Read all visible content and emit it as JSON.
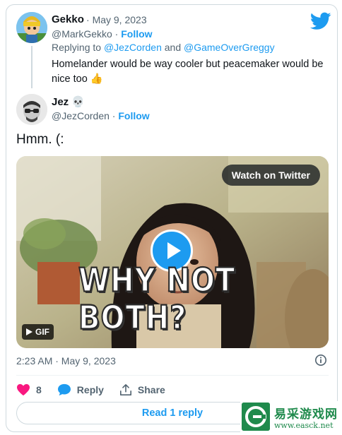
{
  "quoted_tweet": {
    "display_name": "Gekko",
    "date": "May 9, 2023",
    "handle": "@MarkGekko",
    "follow_label": "Follow",
    "replying_prefix": "Replying to",
    "replying_user_1": "@JezCorden",
    "replying_and": "and",
    "replying_user_2": "@GameOverGreggy",
    "text": "Homelander would be way cooler but peacemaker would be nice too 👍"
  },
  "tweet": {
    "display_name": "Jez",
    "name_emoji": "💀",
    "handle": "@JezCorden",
    "follow_label": "Follow",
    "text": "Hmm. (:",
    "timestamp": "2:23 AM · May 9, 2023"
  },
  "media": {
    "watch_label": "Watch on Twitter",
    "gif_badge": "GIF",
    "caption": "WHY NOT BOTH?"
  },
  "actions": {
    "like_count": "8",
    "reply_label": "Reply",
    "share_label": "Share"
  },
  "read_reply_label": "Read 1 reply",
  "watermark": {
    "title": "易采游戏网",
    "url": "www.easck.net"
  },
  "colors": {
    "accent": "#1d9bf0",
    "like": "#f91880",
    "text": "#0f1419",
    "muted": "#536471",
    "border": "#cfd9de"
  },
  "icons": [
    "twitter-bird-icon",
    "play-icon",
    "gif-play-icon",
    "heart-icon",
    "reply-bubble-icon",
    "share-icon",
    "info-icon"
  ]
}
